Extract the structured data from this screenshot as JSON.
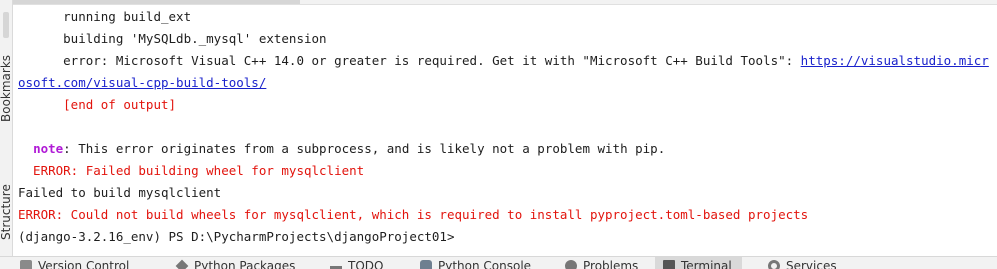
{
  "sidebar": {
    "tabs": [
      {
        "label": "Bookmarks"
      },
      {
        "label": "Structure"
      }
    ]
  },
  "terminal": {
    "lines": [
      {
        "segments": [
          {
            "text": "      running build_ext"
          }
        ]
      },
      {
        "segments": [
          {
            "text": "      building 'MySQLdb._mysql' extension"
          }
        ]
      },
      {
        "segments": [
          {
            "text": "      error: Microsoft Visual C++ 14.0 or greater is required. Get it with \"Microsoft C++ Build Tools\": "
          },
          {
            "text": "https://visualstudio.micr",
            "link": true
          }
        ]
      },
      {
        "segments": [
          {
            "text": "osoft.com/visual-cpp-build-tools/",
            "link": true
          }
        ]
      },
      {
        "segments": [
          {
            "text": "      [end of output]",
            "error": true
          }
        ]
      },
      {
        "segments": [
          {
            "text": ""
          }
        ]
      },
      {
        "segments": [
          {
            "text": "  "
          },
          {
            "text": "note",
            "note": true
          },
          {
            "text": ": This error originates from a subprocess, and is likely not a problem with pip."
          }
        ]
      },
      {
        "segments": [
          {
            "text": "  ERROR: Failed building wheel for mysqlclient",
            "error": true
          }
        ]
      },
      {
        "segments": [
          {
            "text": "Failed to build mysqlclient"
          }
        ]
      },
      {
        "segments": [
          {
            "text": "ERROR: Could not build wheels for mysqlclient, which is required to install pyproject.toml-based projects",
            "error": true
          }
        ]
      },
      {
        "segments": [
          {
            "text": "(django-3.2.16_env) PS D:\\PycharmProjects\\djangoProject01>"
          }
        ]
      }
    ]
  },
  "bottom_tabs": [
    {
      "label": "Version Control",
      "icon": "version-control-icon"
    },
    {
      "label": "Python Packages",
      "icon": "python-packages-icon"
    },
    {
      "label": "TODO",
      "icon": "todo-icon"
    },
    {
      "label": "Python Console",
      "icon": "python-console-icon"
    },
    {
      "label": "Problems",
      "icon": "problems-icon"
    },
    {
      "label": "Terminal",
      "icon": "terminal-icon",
      "active": true
    },
    {
      "label": "Services",
      "icon": "services-icon"
    }
  ]
}
